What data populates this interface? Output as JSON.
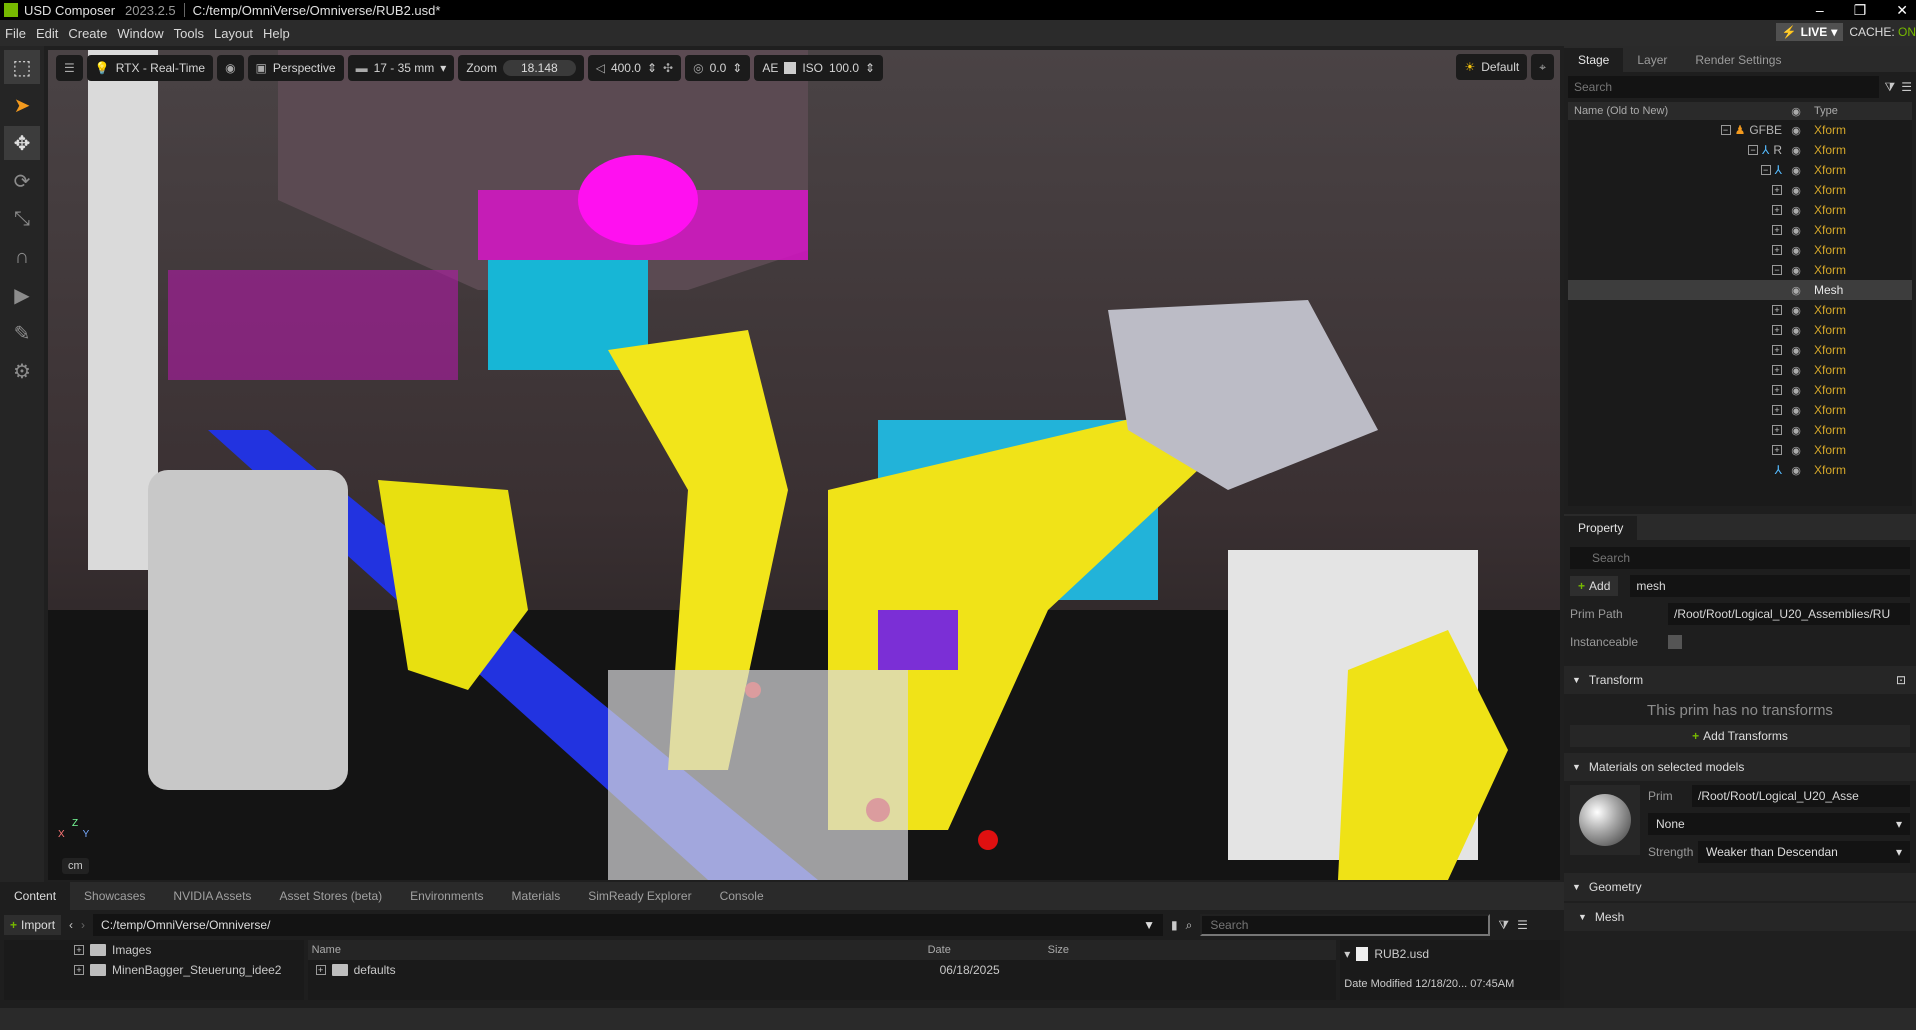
{
  "titlebar": {
    "app": "USD Composer",
    "version": "2023.2.5",
    "path": "C:/temp/OmniVerse/Omniverse/RUB2.usd*"
  },
  "menu": [
    "File",
    "Edit",
    "Create",
    "Window",
    "Tools",
    "Layout",
    "Help"
  ],
  "status": {
    "live": "LIVE",
    "cache_label": "CACHE:",
    "cache_value": "ON"
  },
  "viewport": {
    "renderer": "RTX - Real-Time",
    "camera": "Perspective",
    "lens": "17 - 35 mm",
    "zoom_label": "Zoom",
    "zoom_value": "18.148",
    "speed_value": "400.0",
    "exposure_value": "0.0",
    "ae_label": "AE",
    "iso_label": "ISO",
    "iso_value": "100.0",
    "lighting": "Default",
    "unit": "cm",
    "axis_z": "Z",
    "axis_x": "X",
    "axis_y": "Y"
  },
  "stage": {
    "tabs": [
      "Stage",
      "Layer",
      "Render Settings"
    ],
    "search_placeholder": "Search",
    "col_name": "Name (Old to New)",
    "col_type": "Type",
    "rows": [
      {
        "name": "GFBE",
        "type": "Xform"
      },
      {
        "name": "R",
        "type": "Xform"
      },
      {
        "name": "",
        "type": "Xform"
      },
      {
        "name": "",
        "type": "Xform"
      },
      {
        "name": "",
        "type": "Xform"
      },
      {
        "name": "",
        "type": "Xform"
      },
      {
        "name": "",
        "type": "Xform"
      },
      {
        "name": "",
        "type": "Xform"
      },
      {
        "name": "",
        "type": "Mesh"
      },
      {
        "name": "",
        "type": "Xform"
      },
      {
        "name": "",
        "type": "Xform"
      },
      {
        "name": "",
        "type": "Xform"
      },
      {
        "name": "",
        "type": "Xform"
      },
      {
        "name": "",
        "type": "Xform"
      },
      {
        "name": "",
        "type": "Xform"
      },
      {
        "name": "",
        "type": "Xform"
      },
      {
        "name": "",
        "type": "Xform"
      },
      {
        "name": "",
        "type": "Xform"
      }
    ]
  },
  "property": {
    "tab": "Property",
    "search_placeholder": "Search",
    "add_label": "Add",
    "name_value": "mesh",
    "prim_path_label": "Prim Path",
    "prim_path_value": "/Root/Root/Logical_U20_Assemblies/RU",
    "instanceable_label": "Instanceable",
    "transform_title": "Transform",
    "no_transforms": "This prim has no transforms",
    "add_transforms": "Add Transforms",
    "materials_title": "Materials on selected models",
    "prim_label": "Prim",
    "prim_value": "/Root/Root/Logical_U20_Asse",
    "material_value": "None",
    "strength_label": "Strength",
    "strength_value": "Weaker than Descendan",
    "geometry_title": "Geometry",
    "mesh_title": "Mesh"
  },
  "content": {
    "tabs": [
      "Content",
      "Showcases",
      "NVIDIA Assets",
      "Asset Stores (beta)",
      "Environments",
      "Materials",
      "SimReady Explorer",
      "Console"
    ],
    "import_label": "Import",
    "path": "C:/temp/OmniVerse/Omniverse/",
    "search_placeholder": "Search",
    "tree": [
      "Images",
      "MinenBagger_Steuerung_idee2"
    ],
    "col_name": "Name",
    "col_date": "Date",
    "col_size": "Size",
    "file_name": "defaults",
    "file_date": "06/18/2025",
    "detail_file": "RUB2.usd",
    "detail_modified": "Date Modified 12/18/20... 07:45AM"
  }
}
